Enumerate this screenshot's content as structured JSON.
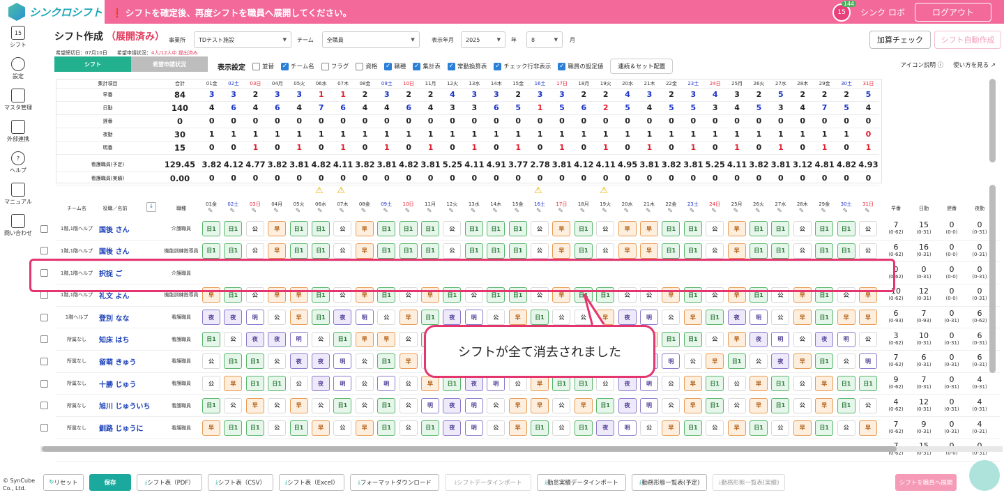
{
  "app": {
    "name": "シンクロシフト",
    "notice": "シフトを確定後、再度シフトを職員へ展開してください。",
    "user": "シンク ロボ",
    "logout": "ログアウト",
    "badge": "144",
    "calendar_day": "15"
  },
  "nav": [
    {
      "icon": "calendar-icon",
      "label": "シフト"
    },
    {
      "icon": "gear-icon",
      "label": "設定"
    },
    {
      "icon": "database-icon",
      "label": "マスタ管理"
    },
    {
      "icon": "cloud-icon",
      "label": "外部連携"
    },
    {
      "icon": "help-icon",
      "label": "ヘルプ"
    },
    {
      "icon": "manual-icon",
      "label": "マニュアル"
    },
    {
      "icon": "mail-icon",
      "label": "問い合わせ"
    }
  ],
  "header": {
    "title": "シフト作成",
    "state": "（展開済み）",
    "office_label": "事業所",
    "office": "TDテスト施設",
    "team_label": "チーム",
    "team": "全職員",
    "ym_label": "表示年月",
    "year": "2025",
    "year_unit": "年",
    "month": "8",
    "month_unit": "月",
    "calc_check": "加算チェック",
    "auto_create": "シフト自動作成",
    "deadline": "希望締切日：07月10日",
    "status_label": "希望申請状況：",
    "status": "4人/12人中 提出済み"
  },
  "tabs": [
    "シフト",
    "希望申請状況"
  ],
  "display": {
    "label": "表示設定",
    "options": [
      {
        "label": "並替",
        "checked": false
      },
      {
        "label": "チーム名",
        "checked": true
      },
      {
        "label": "フラグ",
        "checked": false
      },
      {
        "label": "資格",
        "checked": false
      },
      {
        "label": "職種",
        "checked": true
      },
      {
        "label": "集計表",
        "checked": true
      },
      {
        "label": "常勤換算表",
        "checked": true
      },
      {
        "label": "チェック行非表示",
        "checked": true
      },
      {
        "label": "職員の設定値",
        "checked": true
      }
    ],
    "set_button": "連続＆セット配置"
  },
  "help_links": [
    "アイコン説明",
    "使い方を見る"
  ],
  "days": [
    "01金",
    "02土",
    "03日",
    "04月",
    "05火",
    "06水",
    "07木",
    "08金",
    "09土",
    "10日",
    "11月",
    "12火",
    "13水",
    "14木",
    "15金",
    "16土",
    "17日",
    "18月",
    "19火",
    "20水",
    "21木",
    "22金",
    "23土",
    "24日",
    "25月",
    "26火",
    "27水",
    "28木",
    "29金",
    "30土",
    "31日"
  ],
  "summary": {
    "header_item": "集計項目",
    "header_total": "合計",
    "rows": [
      {
        "label": "早番",
        "total": "84",
        "vals": [
          "3",
          "3",
          "2",
          "3",
          "3",
          "1",
          "1",
          "2",
          "3",
          "2",
          "2",
          "4",
          "3",
          "3",
          "2",
          "3",
          "3",
          "2",
          "2",
          "4",
          "3",
          "2",
          "3",
          "4",
          "3",
          "2",
          "5",
          "2",
          "2",
          "2",
          "5"
        ],
        "colors": "bbkbbrrkbkkbbbkbbkkbbkbbkkbkkkb"
      },
      {
        "label": "日勤",
        "total": "140",
        "vals": [
          "4",
          "6",
          "4",
          "6",
          "4",
          "7",
          "6",
          "4",
          "4",
          "6",
          "4",
          "3",
          "3",
          "6",
          "5",
          "1",
          "5",
          "6",
          "2",
          "5",
          "4",
          "5",
          "5",
          "3",
          "4",
          "5",
          "3",
          "4",
          "7",
          "5",
          "4"
        ],
        "colors": "kbkbkbbkkbkkkbbrbbrbkbbkkbkkbbk"
      },
      {
        "label": "遅番",
        "total": "0",
        "vals": [
          "0",
          "0",
          "0",
          "0",
          "0",
          "0",
          "0",
          "0",
          "0",
          "0",
          "0",
          "0",
          "0",
          "0",
          "0",
          "0",
          "0",
          "0",
          "0",
          "0",
          "0",
          "0",
          "0",
          "0",
          "0",
          "0",
          "0",
          "0",
          "0",
          "0",
          "0"
        ],
        "colors": "kkkkkkkkkkkkkkkkkkkkkkkkkkkkkkk"
      },
      {
        "label": "夜勤",
        "total": "30",
        "vals": [
          "1",
          "1",
          "1",
          "1",
          "1",
          "1",
          "1",
          "1",
          "1",
          "1",
          "1",
          "1",
          "1",
          "1",
          "1",
          "1",
          "1",
          "1",
          "1",
          "1",
          "1",
          "1",
          "1",
          "1",
          "1",
          "1",
          "1",
          "1",
          "1",
          "1",
          "0"
        ],
        "colors": "kkkkkkkkkkkkkkkkkkkkkkkkkkkkkkr"
      },
      {
        "label": "明番",
        "total": "15",
        "vals": [
          "0",
          "0",
          "1",
          "0",
          "1",
          "0",
          "1",
          "0",
          "1",
          "0",
          "1",
          "0",
          "1",
          "0",
          "1",
          "0",
          "1",
          "0",
          "1",
          "0",
          "1",
          "0",
          "1",
          "0",
          "1",
          "0",
          "1",
          "0",
          "1",
          "0",
          "1"
        ],
        "colors": "kkrkrkrkrkrkrkrkrkrkrkrkrkrkrkr"
      },
      {
        "label": "看護職員(予定)",
        "total": "129.45",
        "vals": [
          "3.82",
          "4.12",
          "4.77",
          "3.82",
          "3.81",
          "4.82",
          "4.11",
          "3.82",
          "3.81",
          "4.82",
          "3.81",
          "5.25",
          "4.11",
          "4.91",
          "3.77",
          "2.78",
          "3.81",
          "4.12",
          "4.11",
          "4.95",
          "3.81",
          "3.82",
          "3.81",
          "5.25",
          "4.11",
          "3.82",
          "3.81",
          "3.12",
          "4.81",
          "4.82",
          "4.93"
        ],
        "colors": "kkkkkkkkkkkkkkkkkkkkkkkkkkkkkkk"
      },
      {
        "label": "看護職員(実績)",
        "total": "0.00",
        "vals": [
          "0",
          "0",
          "0",
          "0",
          "0",
          "0",
          "0",
          "0",
          "0",
          "0",
          "0",
          "0",
          "0",
          "0",
          "0",
          "0",
          "0",
          "0",
          "0",
          "0",
          "0",
          "0",
          "0",
          "0",
          "0",
          "0",
          "0",
          "0",
          "0",
          "0",
          "0"
        ],
        "colors": "kkkkkkkkkkkkkkkkkkkkkkkkkkkkkkk"
      }
    ]
  },
  "grid": {
    "h_team": "チーム名",
    "h_name": "役職／名前",
    "h_role": "職種",
    "stat_heads": [
      "早番",
      "日勤",
      "遅番",
      "夜勤"
    ],
    "rows": [
      {
        "team": "1階,1階ヘルプ",
        "name": "国後 さん",
        "role": "介護職員",
        "cells": [
          "日1",
          "日1",
          "公",
          "早",
          "日1",
          "日1",
          "公",
          "早",
          "日1",
          "日1",
          "日1",
          "公",
          "日1",
          "日1",
          "日1",
          "公",
          "早",
          "日1",
          "公",
          "早",
          "早",
          "日1",
          "日1",
          "公",
          "早",
          "日1",
          "日1",
          "公",
          "日1",
          "日1",
          "公"
        ],
        "stats": [
          [
            "7",
            "(0-62)"
          ],
          [
            "15",
            "(0-31)"
          ],
          [
            "0",
            "(0-0)"
          ],
          [
            "0",
            "(0-31)"
          ]
        ]
      },
      {
        "team": "1階,1階ヘルプ",
        "name": "国後 さん",
        "role": "機能訓練指導員",
        "cells": [
          "日1",
          "日1",
          "公",
          "早",
          "日1",
          "日1",
          "公",
          "早",
          "日1",
          "日1",
          "日1",
          "公",
          "日1",
          "日1",
          "日1",
          "公",
          "早",
          "日1",
          "公",
          "早",
          "早",
          "日1",
          "日1",
          "公",
          "早",
          "日1",
          "日1",
          "公",
          "日1",
          "日1",
          "公"
        ],
        "stats": [
          [
            "6",
            "(0-62)"
          ],
          [
            "16",
            "(0-31)"
          ],
          [
            "0",
            "(0-0)"
          ],
          [
            "0",
            "(0-31)"
          ]
        ]
      },
      {
        "team": "1階,1階ヘルプ",
        "name": "択捉 ご",
        "role": "介護職員",
        "cells": [],
        "stats": [
          [
            "0",
            "(0-62)"
          ],
          [
            "0",
            "(0-31)"
          ],
          [
            "0",
            "(0-0)"
          ],
          [
            "0",
            "(0-31)"
          ]
        ]
      },
      {
        "team": "1階,1階ヘルプ",
        "name": "礼文 よん",
        "role": "機能訓練指導員",
        "cells": [
          "早",
          "日1",
          "公",
          "早",
          "早",
          "日1",
          "公",
          "早",
          "日1",
          "公",
          "早",
          "日1",
          "公",
          "日1",
          "日1",
          "公",
          "早",
          "日1",
          "日1",
          "公",
          "公",
          "早",
          "日1",
          "公",
          "早",
          "日1",
          "公",
          "早",
          "日1",
          "公",
          "早"
        ],
        "stats": [
          [
            "10",
            "(0-62)"
          ],
          [
            "12",
            "(0-31)"
          ],
          [
            "0",
            "(0-0)"
          ],
          [
            "0",
            "(0-31)"
          ]
        ]
      },
      {
        "team": "1階ヘルプ",
        "name": "登別 なな",
        "role": "看護職員",
        "cells": [
          "夜",
          "夜",
          "明",
          "公",
          "早",
          "日1",
          "夜",
          "明",
          "公",
          "早",
          "日1",
          "夜",
          "明",
          "公",
          "早",
          "日1",
          "公",
          "公",
          "早",
          "夜",
          "明",
          "公",
          "早",
          "日1",
          "夜",
          "明",
          "公",
          "早",
          "日1",
          "早",
          "早"
        ],
        "stats": [
          [
            "6",
            "(0-93)"
          ],
          [
            "7",
            "(0-93)"
          ],
          [
            "0",
            "(0-31)"
          ],
          [
            "6",
            "(0-62)"
          ]
        ]
      },
      {
        "team": "所属なし",
        "name": "知床 はち",
        "role": "看護職員",
        "cells": [
          "日1",
          "公",
          "夜",
          "夜",
          "明",
          "公",
          "日1",
          "早",
          "早",
          "公",
          "日1",
          "夜",
          "明",
          "公",
          "早",
          "日1",
          "夜",
          "明",
          "公",
          "日1",
          "早",
          "日1",
          "日1",
          "公",
          "早",
          "夜",
          "明",
          "公",
          "夜",
          "明",
          "公"
        ],
        "stats": [
          [
            "3",
            "(0-62)"
          ],
          [
            "10",
            "(0-31)"
          ],
          [
            "0",
            "(0-31)"
          ],
          [
            "6",
            "(0-31)"
          ]
        ]
      },
      {
        "team": "所属なし",
        "name": "留萌 きゅう",
        "role": "看護職員",
        "cells": [
          "公",
          "日1",
          "日1",
          "公",
          "夜",
          "夜",
          "明",
          "公",
          "日1",
          "早",
          "公",
          "日1",
          "夜",
          "明",
          "公",
          "早",
          "日1",
          "公",
          "早",
          "日1",
          "夜",
          "明",
          "公",
          "早",
          "日1",
          "公",
          "夜",
          "早",
          "日1",
          "公",
          "明"
        ],
        "stats": [
          [
            "7",
            "(0-62)"
          ],
          [
            "6",
            "(0-31)"
          ],
          [
            "0",
            "(0-31)"
          ],
          [
            "6",
            "(0-31)"
          ]
        ]
      },
      {
        "team": "所属なし",
        "name": "十勝 じゅう",
        "role": "看護職員",
        "cells": [
          "公",
          "早",
          "日1",
          "日1",
          "公",
          "夜",
          "明",
          "公",
          "明",
          "公",
          "早",
          "日1",
          "夜",
          "明",
          "公",
          "早",
          "日1",
          "日1",
          "公",
          "夜",
          "明",
          "公",
          "早",
          "日1",
          "公",
          "早",
          "日1",
          "公",
          "早",
          "日1",
          "日1"
        ],
        "stats": [
          [
            "9",
            "(0-62)"
          ],
          [
            "7",
            "(0-31)"
          ],
          [
            "0",
            "(0-31)"
          ],
          [
            "4",
            "(0-31)"
          ]
        ]
      },
      {
        "team": "所属なし",
        "name": "旭川 じゅういち",
        "role": "看護職員",
        "cells": [
          "日1",
          "公",
          "早",
          "公",
          "早",
          "公",
          "日1",
          "公",
          "日1",
          "公",
          "明",
          "夜",
          "明",
          "公",
          "早",
          "早",
          "公",
          "早",
          "日1",
          "夜",
          "明",
          "公",
          "早",
          "日1",
          "公",
          "早",
          "日1",
          "公",
          "早",
          "日1",
          "公"
        ],
        "stats": [
          [
            "4",
            "(0-62)"
          ],
          [
            "12",
            "(0-31)"
          ],
          [
            "0",
            "(0-31)"
          ],
          [
            "4",
            "(0-31)"
          ]
        ]
      },
      {
        "team": "所属なし",
        "name": "釧路 じゅうに",
        "role": "看護職員",
        "cells": [
          "早",
          "日1",
          "日1",
          "公",
          "日1",
          "早",
          "公",
          "早",
          "日1",
          "公",
          "日1",
          "夜",
          "明",
          "公",
          "早",
          "日1",
          "公",
          "日1",
          "夜",
          "明",
          "公",
          "早",
          "日1",
          "公",
          "早",
          "日1",
          "公",
          "早",
          "日1",
          "公",
          "早"
        ],
        "stats": [
          [
            "7",
            "(0-62)"
          ],
          [
            "9",
            "(0-31)"
          ],
          [
            "0",
            "(0-31)"
          ],
          [
            "4",
            "(0-31)"
          ]
        ]
      },
      {
        "team": "",
        "name": "",
        "role": "",
        "cells": [],
        "stats": [
          [
            "7",
            "(0-62)"
          ],
          [
            "15",
            "(0-31)"
          ],
          [
            "0",
            "(0-0)"
          ],
          [
            "0",
            "(0-31)"
          ]
        ]
      }
    ]
  },
  "warn_days": [
    5,
    6,
    15,
    18
  ],
  "callout": "シフトが全て消去されました",
  "footer": {
    "copyright": "© SynCube Co., Ltd.",
    "buttons": [
      "リセット",
      "保存",
      "シフト表（PDF）",
      "シフト表（CSV）",
      "シフト表（Excel）",
      "フォーマットダウンロード",
      "シフトデータインポート",
      "勤怠実績データインポート",
      "勤務形態一覧表(予定)",
      "勤務形態一覧表(実績)"
    ],
    "deploy": "シフトを職員へ展開"
  }
}
